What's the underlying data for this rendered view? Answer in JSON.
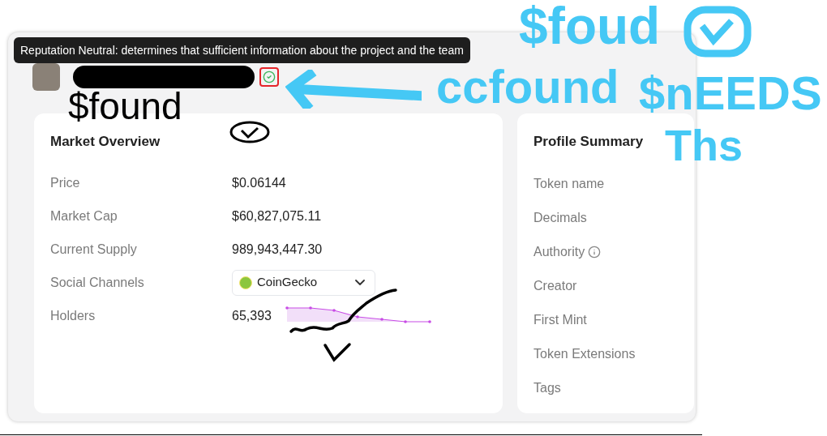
{
  "tooltip": {
    "text": "Reputation Neutral: determines that sufficient information about the project and the team"
  },
  "header": {
    "verified": true
  },
  "market_overview": {
    "title": "Market Overview",
    "rows": [
      {
        "kind": "text",
        "label": "Price",
        "value": "$0.06144"
      },
      {
        "kind": "text",
        "label": "Market Cap",
        "value": "$60,827,075.11"
      },
      {
        "kind": "text",
        "label": "Current Supply",
        "value": "989,943,447.30"
      },
      {
        "kind": "dropdown",
        "label": "Social Channels",
        "value": "CoinGecko"
      },
      {
        "kind": "sparkline",
        "label": "Holders",
        "value": "65,393"
      }
    ]
  },
  "profile_summary": {
    "title": "Profile Summary",
    "items": [
      {
        "label": "Token name",
        "info": false
      },
      {
        "label": "Decimals",
        "info": false
      },
      {
        "label": "Authority",
        "info": true
      },
      {
        "label": "Creator",
        "info": false
      },
      {
        "label": "First Mint",
        "info": false
      },
      {
        "label": "Token Extensions",
        "info": false
      },
      {
        "label": "Tags",
        "info": false
      }
    ]
  },
  "annotations": [
    {
      "text": "$foud",
      "color": "#45c8f5"
    },
    {
      "text": "ccfound",
      "color": "#45c8f5"
    },
    {
      "text": "$nEEDS",
      "color": "#45c8f5"
    },
    {
      "text": "Ths",
      "color": "#45c8f5"
    },
    {
      "text": "$found",
      "color": "#000000"
    }
  ]
}
